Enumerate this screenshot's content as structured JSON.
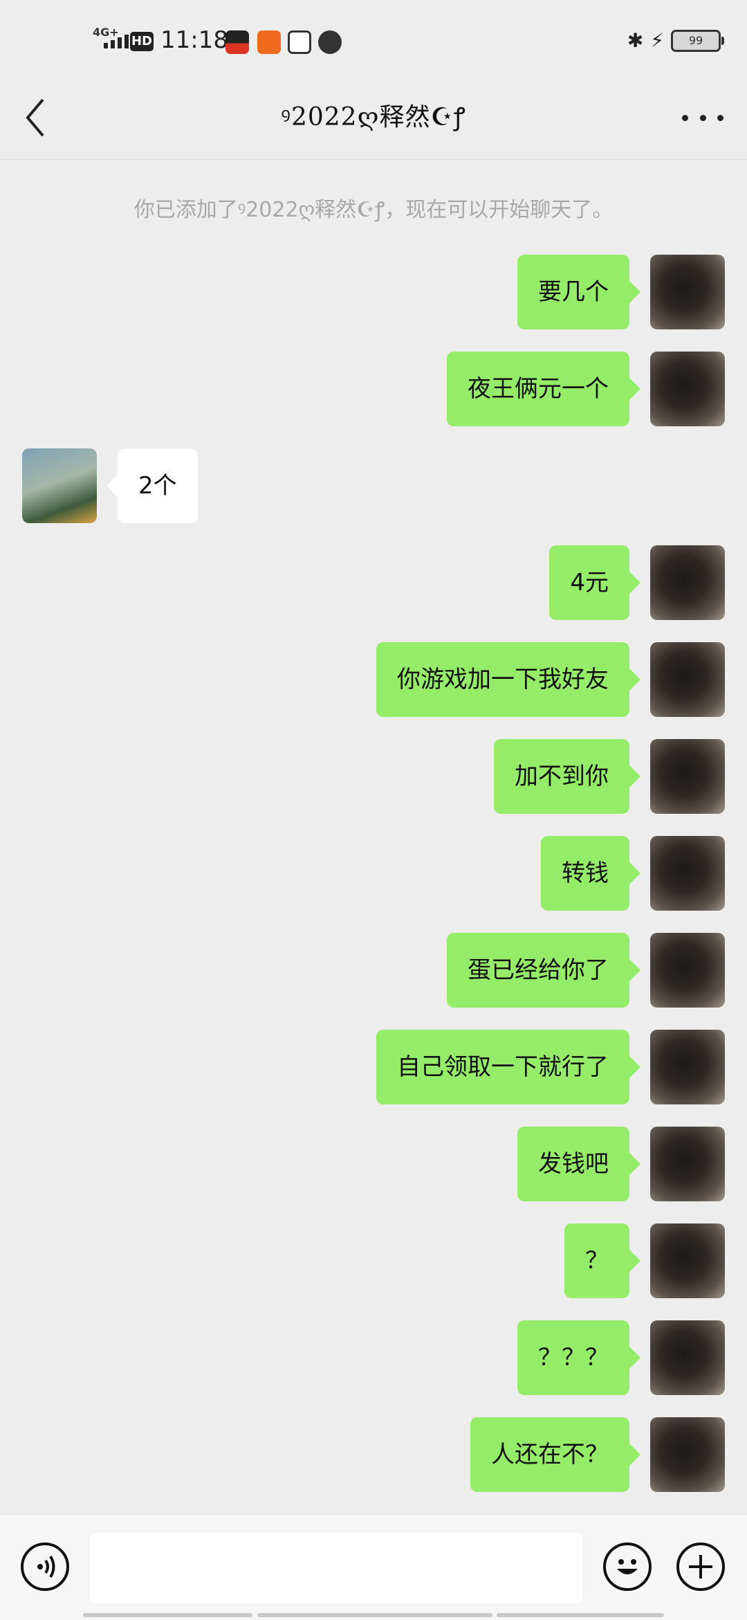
{
  "status_bar": {
    "network": "4G+",
    "hd": "HD",
    "time": "11:18",
    "battery": "99",
    "apps": [
      "app-icon-red",
      "app-icon-orange",
      "app-icon-search",
      "app-icon-q"
    ]
  },
  "header": {
    "title": "ꝰ2022ღ释然☪ꝭ"
  },
  "system_message": "你已添加了ꝰ2022ღ释然☪ꝭ，现在可以开始聊天了。",
  "messages": [
    {
      "sender": "me",
      "text": "要几个"
    },
    {
      "sender": "me",
      "text": "夜王俩元一个"
    },
    {
      "sender": "friend",
      "text": "2个"
    },
    {
      "sender": "me",
      "text": "4元"
    },
    {
      "sender": "me",
      "text": "你游戏加一下我好友"
    },
    {
      "sender": "me",
      "text": "加不到你"
    },
    {
      "sender": "me",
      "text": "转钱"
    },
    {
      "sender": "me",
      "text": "蛋已经给你了"
    },
    {
      "sender": "me",
      "text": "自己领取一下就行了"
    },
    {
      "sender": "me",
      "text": "发钱吧"
    },
    {
      "sender": "me",
      "text": "？"
    },
    {
      "sender": "me",
      "text": "？？？"
    },
    {
      "sender": "me",
      "text": "人还在不？"
    }
  ],
  "colors": {
    "my_bubble": "#95ec69",
    "friend_bubble": "#ffffff",
    "background": "#ededed"
  }
}
